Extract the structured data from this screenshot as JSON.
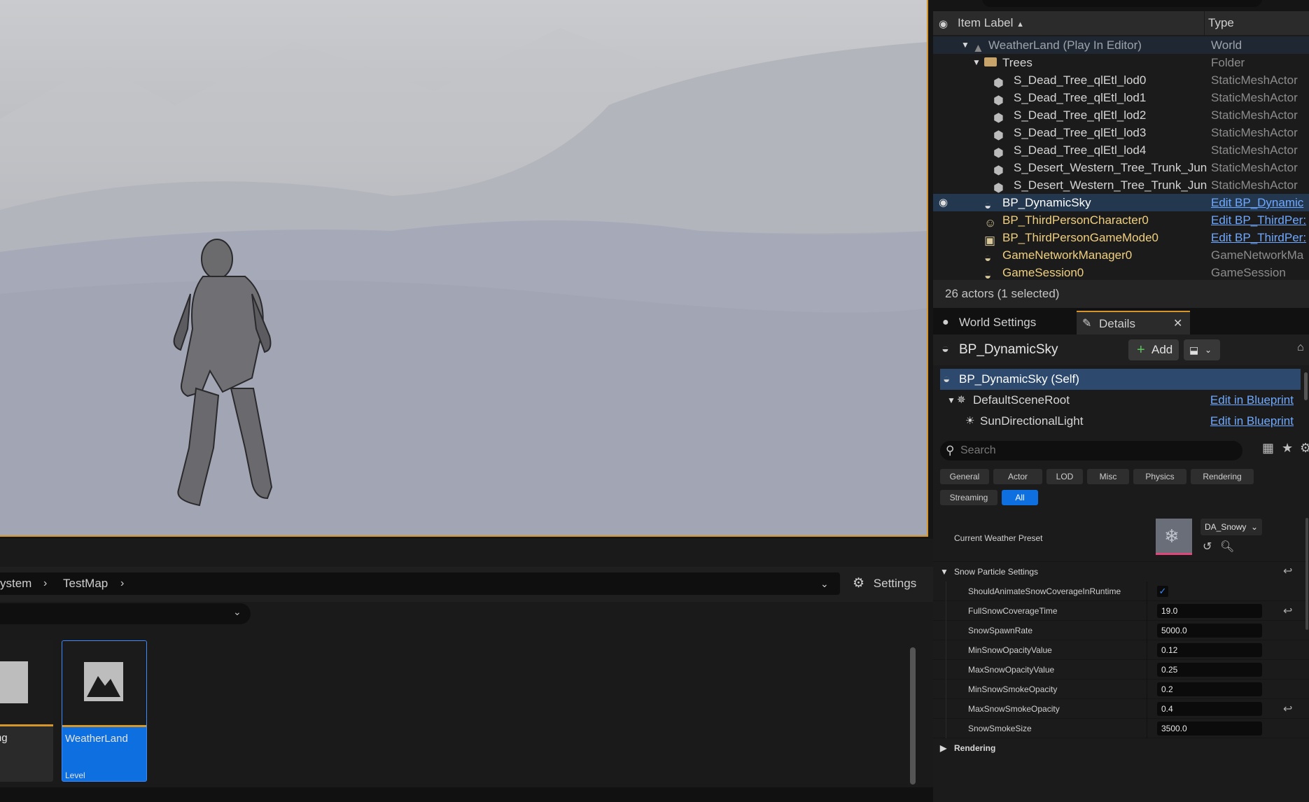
{
  "outliner": {
    "headers": {
      "label": "Item Label",
      "type": "Type"
    },
    "rows": [
      {
        "label": "WeatherLand (Play In Editor)",
        "type": "World"
      },
      {
        "label": "Trees",
        "type": "Folder"
      },
      {
        "label": "S_Dead_Tree_qlEtl_lod0",
        "type": "StaticMeshActor"
      },
      {
        "label": "S_Dead_Tree_qlEtl_lod1",
        "type": "StaticMeshActor"
      },
      {
        "label": "S_Dead_Tree_qlEtl_lod2",
        "type": "StaticMeshActor"
      },
      {
        "label": "S_Dead_Tree_qlEtl_lod3",
        "type": "StaticMeshActor"
      },
      {
        "label": "S_Dead_Tree_qlEtl_lod4",
        "type": "StaticMeshActor"
      },
      {
        "label": "S_Desert_Western_Tree_Trunk_Jun",
        "type": "StaticMeshActor"
      },
      {
        "label": "S_Desert_Western_Tree_Trunk_Jun",
        "type": "StaticMeshActor"
      },
      {
        "label": "BP_DynamicSky",
        "type": "Edit BP_Dynamic"
      },
      {
        "label": "BP_ThirdPersonCharacter0",
        "type": "Edit BP_ThirdPer:"
      },
      {
        "label": "BP_ThirdPersonGameMode0",
        "type": "Edit BP_ThirdPer:"
      },
      {
        "label": "GameNetworkManager0",
        "type": "GameNetworkMa"
      },
      {
        "label": "GameSession0",
        "type": "GameSession"
      }
    ],
    "footer": "26 actors (1 selected)"
  },
  "details": {
    "tabs": {
      "world_settings": "World Settings",
      "details": "Details"
    },
    "actor_name": "BP_DynamicSky",
    "add_label": "Add",
    "components": [
      {
        "label": "BP_DynamicSky (Self)",
        "link": ""
      },
      {
        "label": "DefaultSceneRoot",
        "link": "Edit in Blueprint"
      },
      {
        "label": "SunDirectionalLight",
        "link": "Edit in Blueprint"
      }
    ],
    "search_placeholder": "Search",
    "filter_chips": [
      "General",
      "Actor",
      "LOD",
      "Misc",
      "Physics",
      "Rendering",
      "Streaming",
      "All"
    ],
    "active_chip": "All",
    "weather_preset_label": "Current Weather Preset",
    "weather_preset_value": "DA_Snowy",
    "section_snow": "Snow Particle Settings",
    "checkbox_label": "ShouldAnimateSnowCoverageInRuntime",
    "properties": [
      {
        "name": "FullSnowCoverageTime",
        "value": "19.0"
      },
      {
        "name": "SnowSpawnRate",
        "value": "5000.0"
      },
      {
        "name": "MinSnowOpacityValue",
        "value": "0.12"
      },
      {
        "name": "MaxSnowOpacityValue",
        "value": "0.25"
      },
      {
        "name": "MinSnowSmokeOpacity",
        "value": "0.2"
      },
      {
        "name": "MaxSnowSmokeOpacity",
        "value": "0.4"
      },
      {
        "name": "SnowSmokeSize",
        "value": "3500.0"
      }
    ],
    "section_rendering": "Rendering"
  },
  "content_browser": {
    "breadcrumbs": [
      "ystem",
      "TestMap"
    ],
    "settings_label": "Settings",
    "assets": [
      {
        "name": "Lighting\nap",
        "type": ""
      },
      {
        "name": "WeatherLand",
        "type": "Level"
      }
    ]
  },
  "colors": {
    "accent": "#d7962a",
    "selection": "#0d6fe0",
    "link": "#6ea8ff"
  }
}
